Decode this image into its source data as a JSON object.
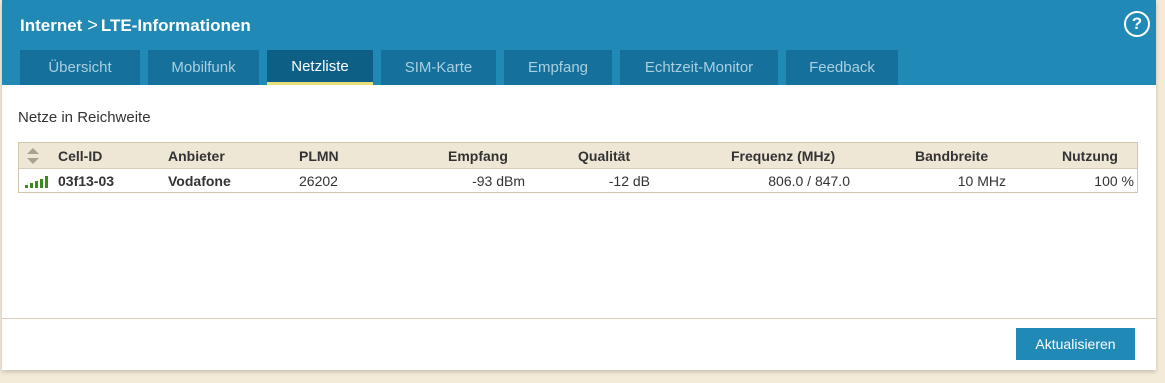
{
  "header": {
    "breadcrumb": [
      "Internet",
      "LTE-Informationen"
    ],
    "separator": ">",
    "help_label": "?"
  },
  "tabs": [
    {
      "label": "Übersicht"
    },
    {
      "label": "Mobilfunk"
    },
    {
      "label": "Netzliste"
    },
    {
      "label": "SIM-Karte"
    },
    {
      "label": "Empfang"
    },
    {
      "label": "Echtzeit-Monitor"
    },
    {
      "label": "Feedback"
    }
  ],
  "active_tab": "Netzliste",
  "section_title": "Netze in Reichweite",
  "table": {
    "columns": [
      "Cell-ID",
      "Anbieter",
      "PLMN",
      "Empfang",
      "Qualität",
      "Frequenz (MHz)",
      "Bandbreite",
      "Nutzung"
    ],
    "rows": [
      {
        "cell_id": "03f13-03",
        "provider": "Vodafone",
        "plmn": "26202",
        "reception": "-93 dBm",
        "quality": "-12 dB",
        "frequency": "806.0 / 847.0",
        "bandwidth": "10 MHz",
        "usage": "100 %",
        "signal_bars": 5
      }
    ]
  },
  "buttons": {
    "refresh_label": "Aktualisieren"
  },
  "icons": {
    "sort": "sort-updown-icon",
    "signal": "signal-strength-icon",
    "help": "help-circle-icon"
  },
  "colors": {
    "header_bg": "#2089b5",
    "tab_bg": "#15719b",
    "tab_active_underline": "#e9e07a",
    "signal_green": "#3a8a1e",
    "table_head_bg": "#efe7d5"
  }
}
